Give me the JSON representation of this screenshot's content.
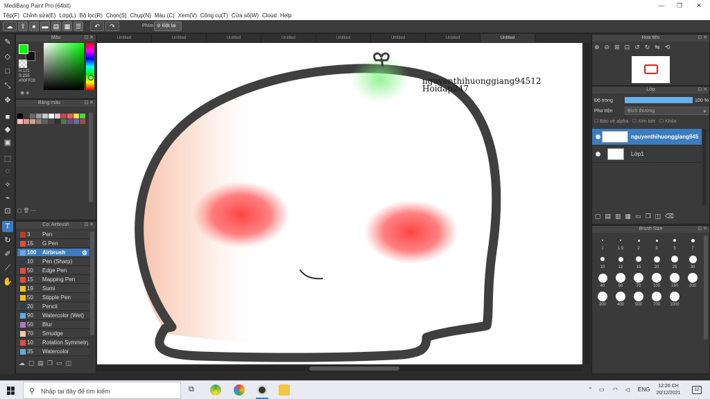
{
  "window": {
    "title": "MediBang Paint Pro (64bit)"
  },
  "menu": [
    "Tệp(F)",
    "Chỉnh sửa(E)",
    "Lớp(L)",
    "Bộ lọc(R)",
    "Chọn(S)",
    "Chụp(N)",
    "Màu (C)",
    "Xem(V)",
    "Công cụ(T)",
    "Cửa sổ(W)",
    "Cloud",
    "Help"
  ],
  "toolbar": {
    "shortcut_label": "Phím",
    "reset_label": "Đặt lại"
  },
  "color_panel": {
    "title": "Màu",
    "h": "H:121",
    "s": "S:255",
    "hex": "#00FF03",
    "main_color": "#00ff03",
    "sub_color": "#111111"
  },
  "palette_panel": {
    "title": "Bảng màu",
    "colors": [
      "#000000",
      "#3a3a3a",
      "#6a6a6a",
      "#9a9a9a",
      "#c8c8c8",
      "#ffffff",
      "#e8c8c8",
      "#c84848",
      "#f06060",
      "#ffe040",
      "#40e040",
      "#f8c0c0",
      "#f09090",
      "#c0a890",
      "#90806a",
      "#606060",
      "#484848",
      "#303030",
      "#4a7a4a",
      "#7a4a7a",
      "#6a6aa8",
      "#a04a4a"
    ],
    "more_label": "---"
  },
  "brush_panel": {
    "title": "Cọ: Airbrush",
    "items": [
      {
        "size": "3",
        "name": "Pen",
        "color": "#c0392b"
      },
      {
        "size": "15",
        "name": "G Pen",
        "color": "#e74c3c"
      },
      {
        "size": "100",
        "name": "Airbrush",
        "color": "#74a6d9"
      },
      {
        "size": "10",
        "name": "Pen (Sharp)",
        "color": "#2c3e50"
      },
      {
        "size": "50",
        "name": "Edge Pen",
        "color": "#e74c3c"
      },
      {
        "size": "15",
        "name": "Mapping Pen",
        "color": "#e74c3c"
      },
      {
        "size": "19",
        "name": "Sumi",
        "color": "#f1c40f"
      },
      {
        "size": "50",
        "name": "Stipple Pen",
        "color": "#f1c40f"
      },
      {
        "size": "20",
        "name": "Pencil",
        "color": "#2c3e50"
      },
      {
        "size": "90",
        "name": "Watercolor (Wet)",
        "color": "#5dade2"
      },
      {
        "size": "50",
        "name": "Blur",
        "color": "#af7ac5"
      },
      {
        "size": "70",
        "name": "Smudge",
        "color": "#f5cba7"
      },
      {
        "size": "10",
        "name": "Rotation Symmetry",
        "color": "#e74c3c"
      },
      {
        "size": "35",
        "name": "Watercolor",
        "color": "#5dade2"
      }
    ]
  },
  "tabs": [
    "Untitled",
    "Untitled",
    "Untitled",
    "Untitled",
    "Untitled",
    "Untitled",
    "Untitled",
    "Untitled"
  ],
  "artwork": {
    "watermark_line1": "nguyenthihuonggiang94512",
    "watermark_line2": "Hoidap247"
  },
  "navigator": {
    "title": "Hoa tiêu"
  },
  "layer_panel": {
    "title": "Lớp",
    "opacity_label": "Độ trong",
    "opacity_value": "100 %",
    "opacity_fraction": 1.0,
    "blend_label": "Pha trộn",
    "blend_value": "Bình thường",
    "protect_alpha": "Bảo vệ alpha",
    "clipping": "Xén bớt",
    "lock": "Khóa",
    "layers": [
      {
        "name": "nguyenthihuonggiang94512",
        "selected": true
      },
      {
        "name": "Lớp1",
        "selected": false
      }
    ]
  },
  "brush_size_panel": {
    "title": "Brush Size",
    "sizes": [
      "1",
      "1.5",
      "2",
      "3",
      "5",
      "7",
      "10",
      "12",
      "15",
      "20",
      "25",
      "30",
      "40",
      "50",
      "70",
      "100",
      "150",
      "200",
      "300",
      "400",
      "500",
      "700",
      "1000"
    ]
  },
  "taskbar": {
    "search_placeholder": "Nhập tại đây để tìm kiếm",
    "language": "ENG",
    "time": "12:26 CH",
    "date": "20/12/2021",
    "notifications": "12"
  }
}
